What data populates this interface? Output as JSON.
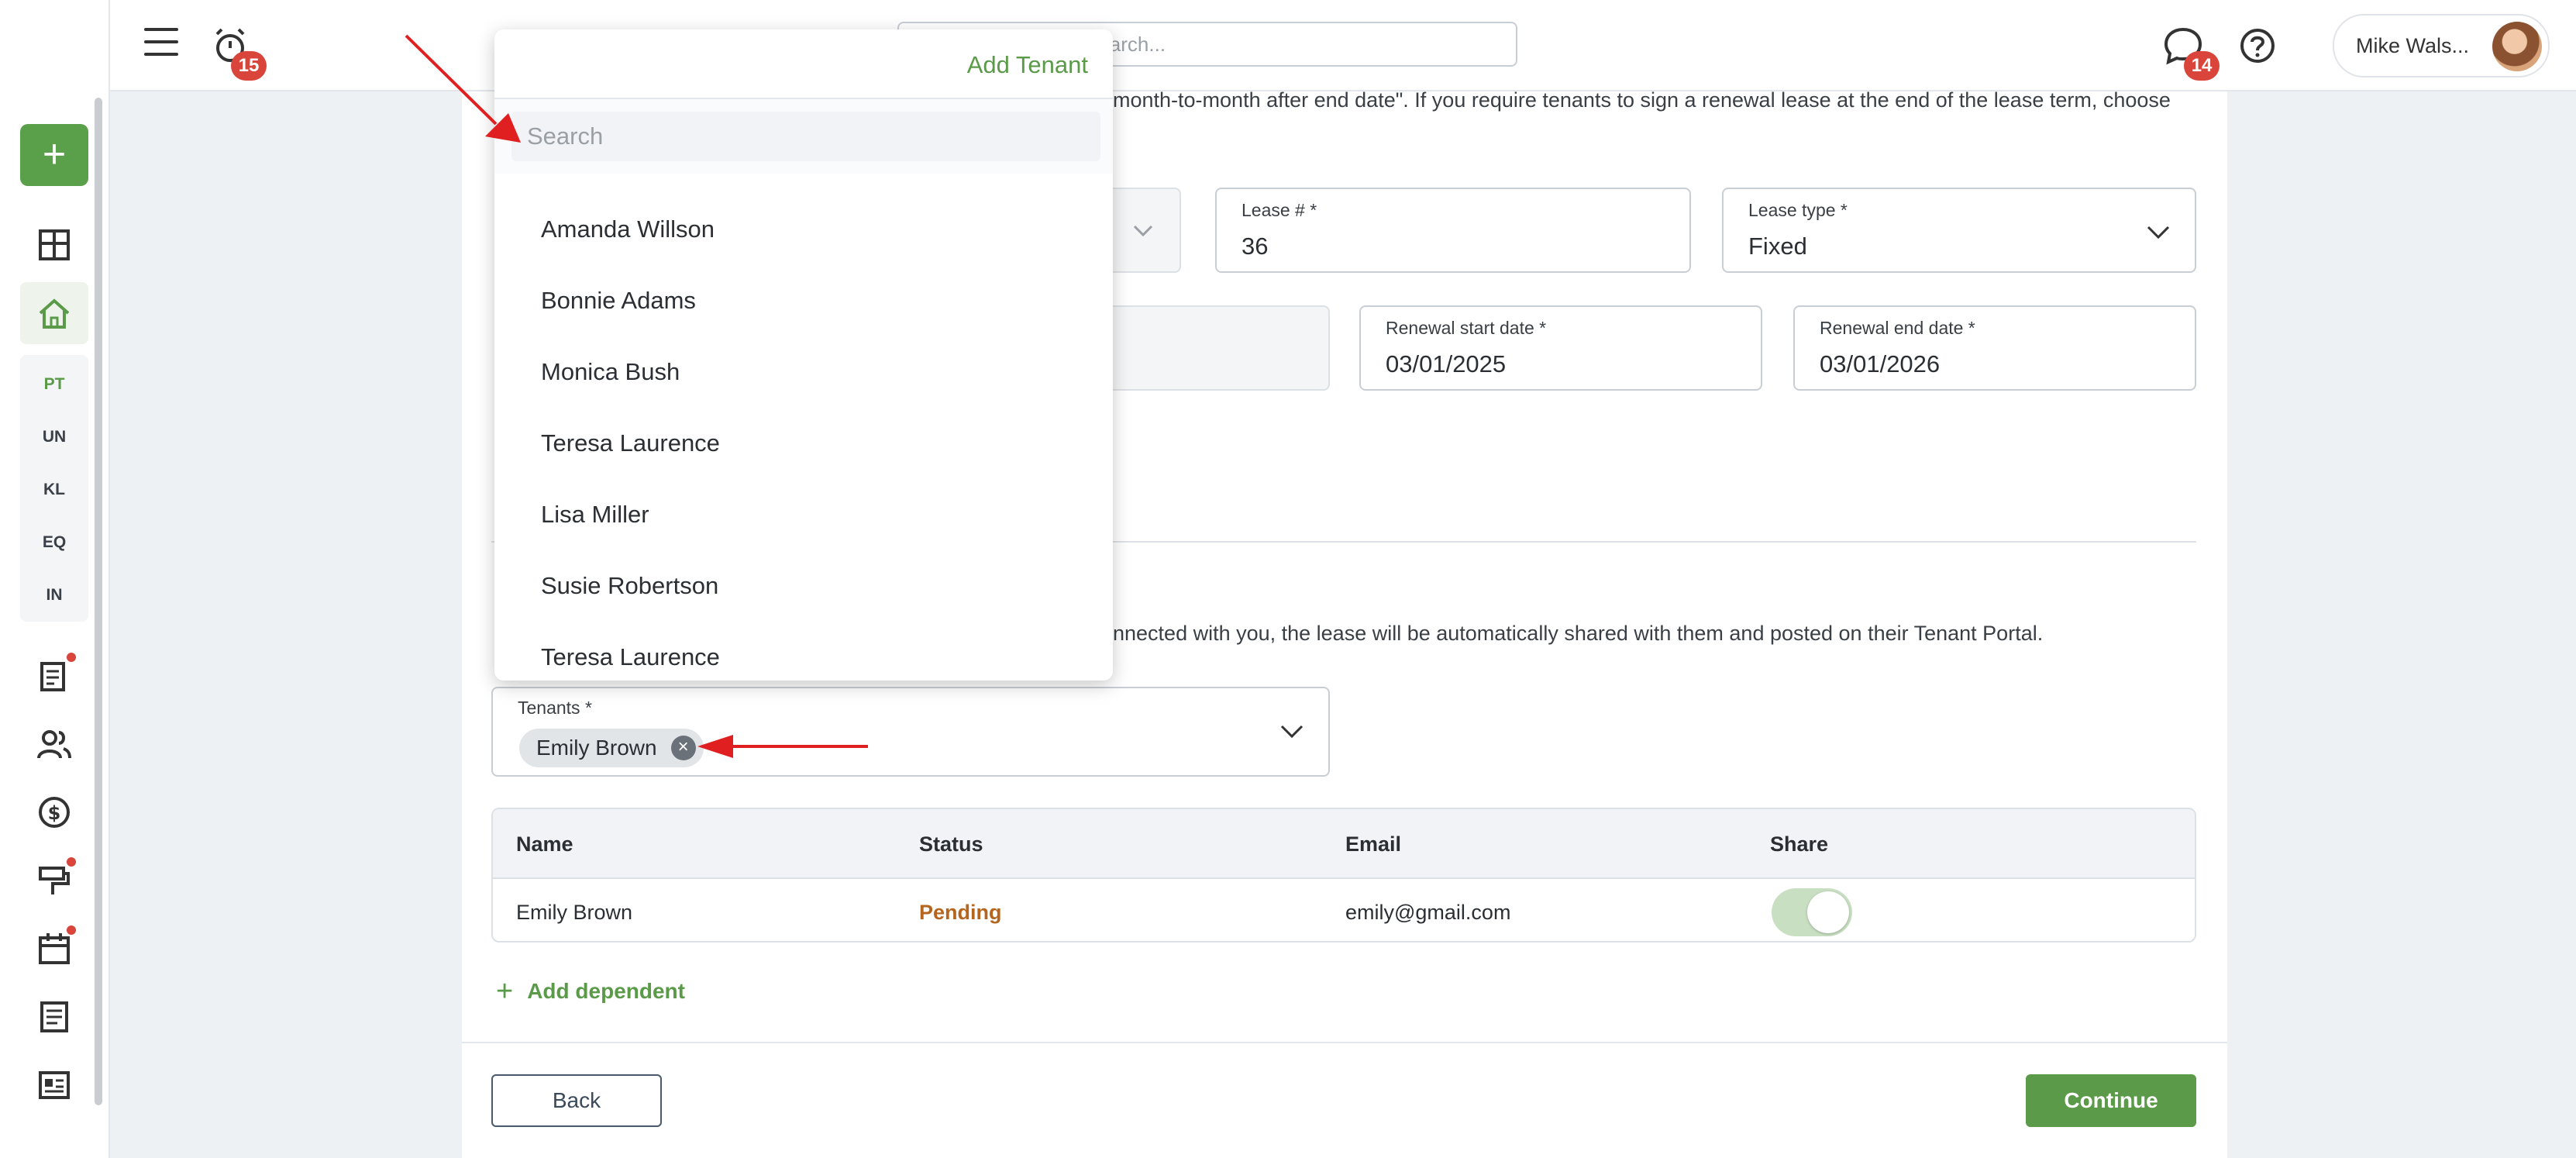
{
  "topbar": {
    "alarm_count": "15",
    "search_placeholder": "Search...",
    "chat_count": "14",
    "user_name": "Mike Wals..."
  },
  "sidebar": {
    "add_label": "+",
    "abbr": [
      "PT",
      "UN",
      "KL",
      "EQ",
      "IN"
    ]
  },
  "form": {
    "help_line_1": "month-to-month after end date\". If you require tenants to sign a renewal lease at the end of the lease term, choose",
    "lease_number": {
      "label": "Lease # *",
      "value": "36"
    },
    "lease_type": {
      "label": "Lease type *",
      "value": "Fixed"
    },
    "renewal_start": {
      "label": "Renewal start date *",
      "value": "03/01/2025"
    },
    "renewal_end": {
      "label": "Renewal end date *",
      "value": "03/01/2026"
    },
    "tenants_help": "nnected with you, the lease will be automatically shared with them and posted on their Tenant Portal.",
    "tenants": {
      "label": "Tenants *",
      "chip": "Emily Brown",
      "chip_remove": "×"
    }
  },
  "table": {
    "headers": [
      "Name",
      "Status",
      "Email",
      "Share"
    ],
    "rows": [
      {
        "name": "Emily Brown",
        "status": "Pending",
        "email": "emily@gmail.com",
        "share": true
      }
    ]
  },
  "actions": {
    "add_dependent": "Add dependent",
    "add_dependent_icon": "+",
    "back": "Back",
    "continue": "Continue"
  },
  "dropdown": {
    "add_tenant": "Add Tenant",
    "search_placeholder": "Search",
    "items": [
      "Amanda Willson",
      "Bonnie Adams",
      "Monica Bush",
      "Teresa Laurence",
      "Lisa Miller",
      "Susie Robertson",
      "Teresa Laurence"
    ]
  },
  "colors": {
    "accent": "#5a9a48",
    "badge": "#d9453b",
    "pending": "#b5651d",
    "annotation_arrow": "#e02020"
  }
}
